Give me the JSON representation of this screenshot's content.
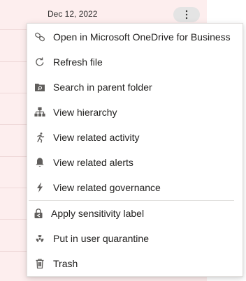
{
  "row": {
    "date": "Dec 12, 2022"
  },
  "context_menu": {
    "items": [
      {
        "label": "Open in Microsoft OneDrive for Business",
        "icon": "link-icon"
      },
      {
        "label": "Refresh file",
        "icon": "refresh-icon"
      },
      {
        "label": "Search in parent folder",
        "icon": "folder-search-icon"
      },
      {
        "label": "View hierarchy",
        "icon": "hierarchy-icon"
      },
      {
        "label": "View related activity",
        "icon": "running-person-icon"
      },
      {
        "label": "View related alerts",
        "icon": "bell-icon"
      },
      {
        "label": "View related governance",
        "icon": "lightning-icon"
      },
      {
        "label": "Apply sensitivity label",
        "icon": "sensitivity-lock-icon"
      },
      {
        "label": "Put in user quarantine",
        "icon": "radiation-icon"
      },
      {
        "label": "Trash",
        "icon": "trash-icon"
      }
    ]
  },
  "colors": {
    "row_highlight": "#fdeeee",
    "icon": "#605e5c",
    "text": "#201f1e"
  }
}
